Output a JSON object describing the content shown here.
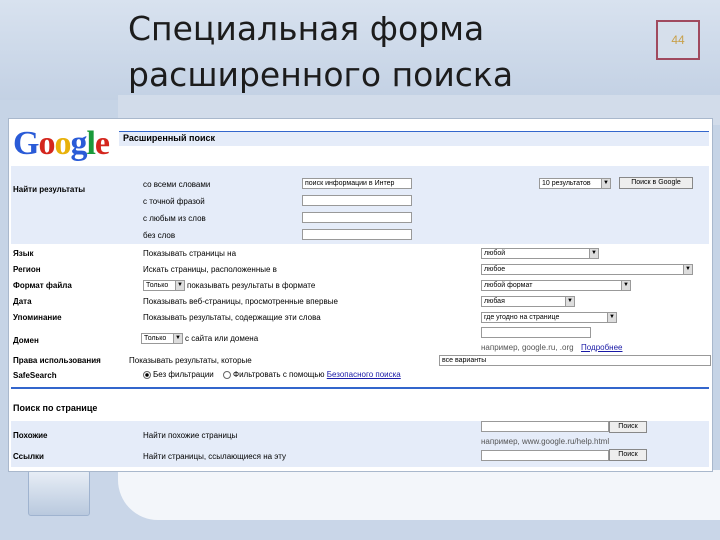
{
  "slide": {
    "title_line1": "Специальная форма",
    "title_line2": "расширенного поиска",
    "number": "44"
  },
  "page": {
    "logo": [
      "G",
      "o",
      "o",
      "g",
      "l",
      "e"
    ],
    "header": "Расширенный поиск",
    "find_results": {
      "label": "Найти результаты",
      "rows": [
        {
          "label": "со всеми словами",
          "value": "поиск информации в Интер"
        },
        {
          "label": "с точной фразой",
          "value": ""
        },
        {
          "label": "с любым из слов",
          "value": ""
        },
        {
          "label": "без слов",
          "value": ""
        }
      ],
      "results_select": "10 результатов",
      "search_button": "Поиск в Google"
    },
    "rows": [
      {
        "label": "Язык",
        "desc": "Показывать страницы на",
        "select": "любой"
      },
      {
        "label": "Регион",
        "desc": "Искать страницы, расположенные в",
        "select": "любое"
      },
      {
        "label": "Формат файла",
        "prefix": "Только",
        "desc": "показывать результаты в формате",
        "select": "любой формат"
      },
      {
        "label": "Дата",
        "desc": "Показывать веб-страницы, просмотренные впервые",
        "select": "любая"
      },
      {
        "label": "Упоминание",
        "desc": "Показывать результаты, содержащие эти слова",
        "select": "где угодно на странице"
      },
      {
        "label": "Домен",
        "prefix": "Только",
        "desc": "с сайта или домена",
        "select": ""
      }
    ],
    "domain_hint": "например, google.ru, .org",
    "domain_link": "Подробнее",
    "usage": {
      "label": "Права использования",
      "desc": "Показывать результаты, которые",
      "select": "все варианты"
    },
    "safesearch": {
      "label": "SafeSearch",
      "option1": "Без фильтрации",
      "option2": "Фильтровать с помощью",
      "link": "Безопасного поиска"
    },
    "page_search": {
      "title": "Поиск по странице",
      "similar": {
        "label": "Похожие",
        "desc": "Найти похожие страницы",
        "button": "Поиск",
        "hint": "например, www.google.ru/help.html"
      },
      "links": {
        "label": "Ссылки",
        "desc": "Найти страницы, ссылающиеся на эту",
        "button": "Поиск"
      }
    }
  }
}
